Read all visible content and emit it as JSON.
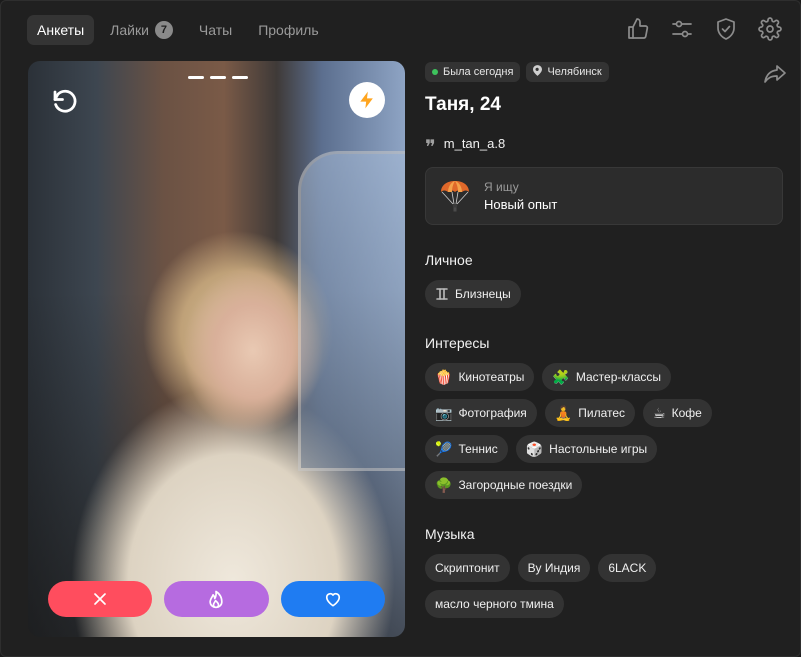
{
  "nav": {
    "tabs": [
      {
        "label": "Анкеты"
      },
      {
        "label": "Лайки",
        "count": "7"
      },
      {
        "label": "Чаты"
      },
      {
        "label": "Профиль"
      }
    ]
  },
  "top_icons": [
    "thumbs-up-icon",
    "sliders-icon",
    "shield-check-icon",
    "gear-icon"
  ],
  "profile": {
    "status": "Была сегодня",
    "city": "Челябинск",
    "name": "Таня, 24",
    "handle": "m_tan_a.8",
    "seeking_label": "Я ищу",
    "seeking_value": "Новый опыт"
  },
  "sections": {
    "personal": {
      "title": "Личное",
      "items": [
        {
          "icon": "gemini-icon",
          "label": "Близнецы"
        }
      ]
    },
    "interests": {
      "title": "Интересы",
      "items": [
        {
          "emoji": "🍿",
          "label": "Кинотеатры"
        },
        {
          "emoji": "🧩",
          "label": "Мастер-классы"
        },
        {
          "emoji": "📷",
          "label": "Фотография"
        },
        {
          "emoji": "🧘",
          "label": "Пилатес"
        },
        {
          "emoji": "☕",
          "label": "Кофе"
        },
        {
          "emoji": "🎾",
          "label": "Теннис"
        },
        {
          "emoji": "🎲",
          "label": "Настольные игры"
        },
        {
          "emoji": "🌳",
          "label": "Загородные поездки"
        }
      ]
    },
    "music": {
      "title": "Музыка",
      "items": [
        {
          "label": "Скриптонит"
        },
        {
          "label": "Ву Индия"
        },
        {
          "label": "6LACK"
        },
        {
          "label": "масло черного тмина"
        }
      ]
    }
  },
  "photo": {
    "page_count": 3,
    "actions": [
      {
        "name": "dislike",
        "icon": "close-icon",
        "color": "#ff4d5e"
      },
      {
        "name": "superlike",
        "icon": "flame-icon",
        "color": "#b66be0"
      },
      {
        "name": "like",
        "icon": "heart-icon",
        "color": "#1f7cf2"
      }
    ],
    "boost_color": "#ffa51f"
  }
}
